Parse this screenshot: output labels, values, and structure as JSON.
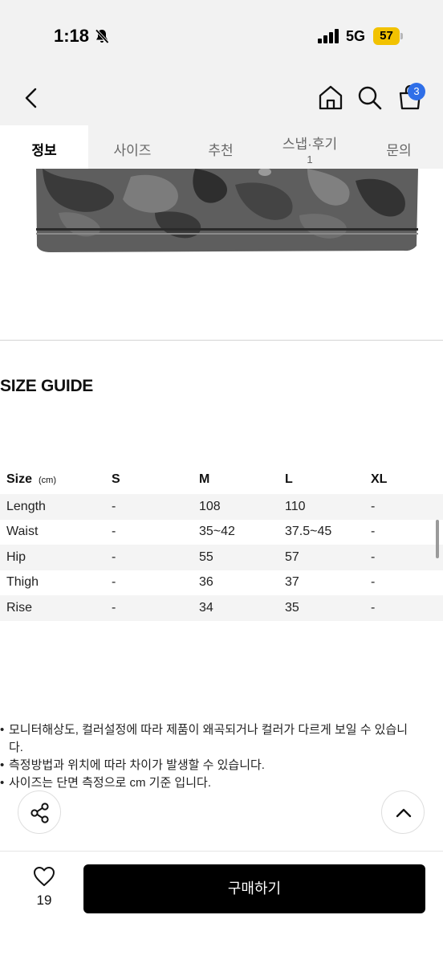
{
  "status_bar": {
    "time": "1:18",
    "network": "5G",
    "battery": "57"
  },
  "header": {
    "cart_count": "3"
  },
  "tabs": [
    {
      "label": "정보",
      "count": ""
    },
    {
      "label": "사이즈",
      "count": ""
    },
    {
      "label": "추천",
      "count": ""
    },
    {
      "label": "스냅·후기",
      "count": "1"
    },
    {
      "label": "문의",
      "count": ""
    }
  ],
  "size_guide": {
    "title": "SIZE GUIDE",
    "header": {
      "label": "Size",
      "unit": "(cm)",
      "sizes": [
        "S",
        "M",
        "L",
        "XL"
      ]
    },
    "rows": [
      {
        "name": "Length",
        "values": [
          "-",
          "108",
          "110",
          "-"
        ]
      },
      {
        "name": "Waist",
        "values": [
          "-",
          "35~42",
          "37.5~45",
          "-"
        ]
      },
      {
        "name": "Hip",
        "values": [
          "-",
          "55",
          "57",
          "-"
        ]
      },
      {
        "name": "Thigh",
        "values": [
          "-",
          "36",
          "37",
          "-"
        ]
      },
      {
        "name": "Rise",
        "values": [
          "-",
          "34",
          "35",
          "-"
        ]
      }
    ]
  },
  "notes": [
    "모니터해상도, 컬러설정에 따라 제품이 왜곡되거나 컬러가 다르게 보일 수 있습니다.",
    "측정방법과 위치에 따라 차이가 발생할 수 있습니다.",
    "사이즈는 단면 측정으로 cm 기준 입니다."
  ],
  "footer": {
    "like_count": "19",
    "buy_label": "구매하기"
  },
  "colors": {
    "badge": "#2f6fe8",
    "battery": "#f2c200",
    "buy_button": "#000000"
  }
}
